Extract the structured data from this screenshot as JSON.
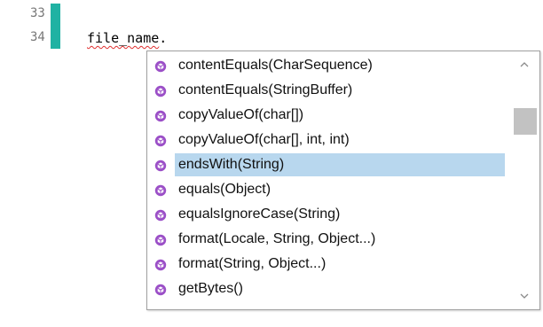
{
  "editor": {
    "line_numbers": [
      "33",
      "34"
    ],
    "code_identifier": "file_name",
    "code_suffix": "."
  },
  "autocomplete": {
    "items": [
      {
        "label": "contentEquals(CharSequence)",
        "icon": "method-icon"
      },
      {
        "label": "contentEquals(StringBuffer)",
        "icon": "method-icon"
      },
      {
        "label": "copyValueOf(char[])",
        "icon": "method-icon"
      },
      {
        "label": "copyValueOf(char[], int, int)",
        "icon": "method-icon"
      },
      {
        "label": "endsWith(String)",
        "icon": "method-icon"
      },
      {
        "label": "equals(Object)",
        "icon": "method-icon"
      },
      {
        "label": "equalsIgnoreCase(String)",
        "icon": "method-icon"
      },
      {
        "label": "format(Locale, String, Object...)",
        "icon": "method-icon"
      },
      {
        "label": "format(String, Object...)",
        "icon": "method-icon"
      },
      {
        "label": "getBytes()",
        "icon": "method-icon"
      }
    ],
    "selected_index": 4,
    "scrollbar": {
      "up_icon": "chevron-up-icon",
      "down_icon": "chevron-down-icon"
    }
  },
  "colors": {
    "change_marker": "#20b2a3",
    "selection": "#b8d7ee",
    "method_icon": "#9b4fc7",
    "error_squiggle": "#e03030"
  }
}
